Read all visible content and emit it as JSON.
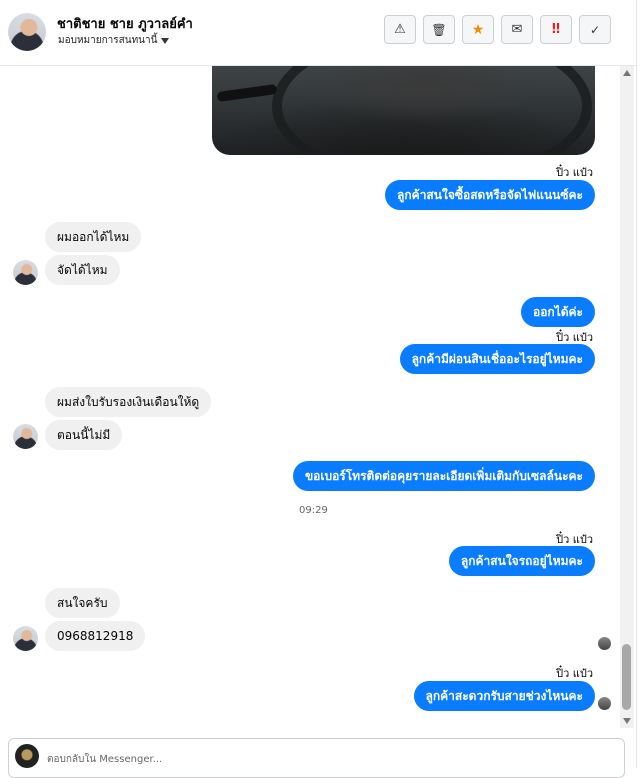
{
  "header": {
    "contact_name": "ชาติชาย ชาย ภูวาลย์คำ",
    "assign_label": "มอบหมายการสนทนานี้",
    "actions": [
      {
        "icon": "warning-icon",
        "glyph": "⚠",
        "color": "#333333"
      },
      {
        "icon": "trash-icon",
        "glyph": "🗑",
        "color": "#333333"
      },
      {
        "icon": "star-icon",
        "glyph": "★",
        "color": "#f08c00"
      },
      {
        "icon": "mail-icon",
        "glyph": "✉",
        "color": "#333333"
      },
      {
        "icon": "urgent-icon",
        "glyph": "‼",
        "color": "#e02424"
      },
      {
        "icon": "check-icon",
        "glyph": "✓",
        "color": "#333333"
      }
    ]
  },
  "messages": {
    "seen_1": "ปิ๋ว แป๋ว",
    "out_1": "ลูกค้าสนใจซื้อสดหรือจัดไฟแนนซ์คะ",
    "in_1": "ผมออกได้ไหม",
    "in_2": "จัดได้ไหม",
    "out_2": "ออกได้ค่ะ",
    "seen_2": "ปิ๋ว แป๋ว",
    "out_3": "ลูกค้ามีผ่อนสินเชื่ออะไรอยู่ไหมคะ",
    "in_3": "ผมส่งใบรับรองเงินเดือนให้ดู",
    "in_4": "ตอนนี้ไม่มี",
    "out_4": "ขอเบอร์โทรติดต่อคุยรายละเอียดเพิ่มเติมกับเซลล์นะคะ",
    "timestamp": "09:29",
    "seen_3": "ปิ๋ว แป๋ว",
    "out_5": "ลูกค้าสนใจรถอยู่ไหมคะ",
    "in_5": "สนใจครับ",
    "in_6": "0968812918",
    "seen_4": "ปิ๋ว แป๋ว",
    "out_6": "ลูกค้าสะดวกรับสายช่วงไหนคะ"
  },
  "composer": {
    "placeholder": "ตอบกลับใน Messenger..."
  },
  "colors": {
    "outgoing_bubble": "#0a7cff",
    "incoming_bubble": "#f0f0f0"
  }
}
